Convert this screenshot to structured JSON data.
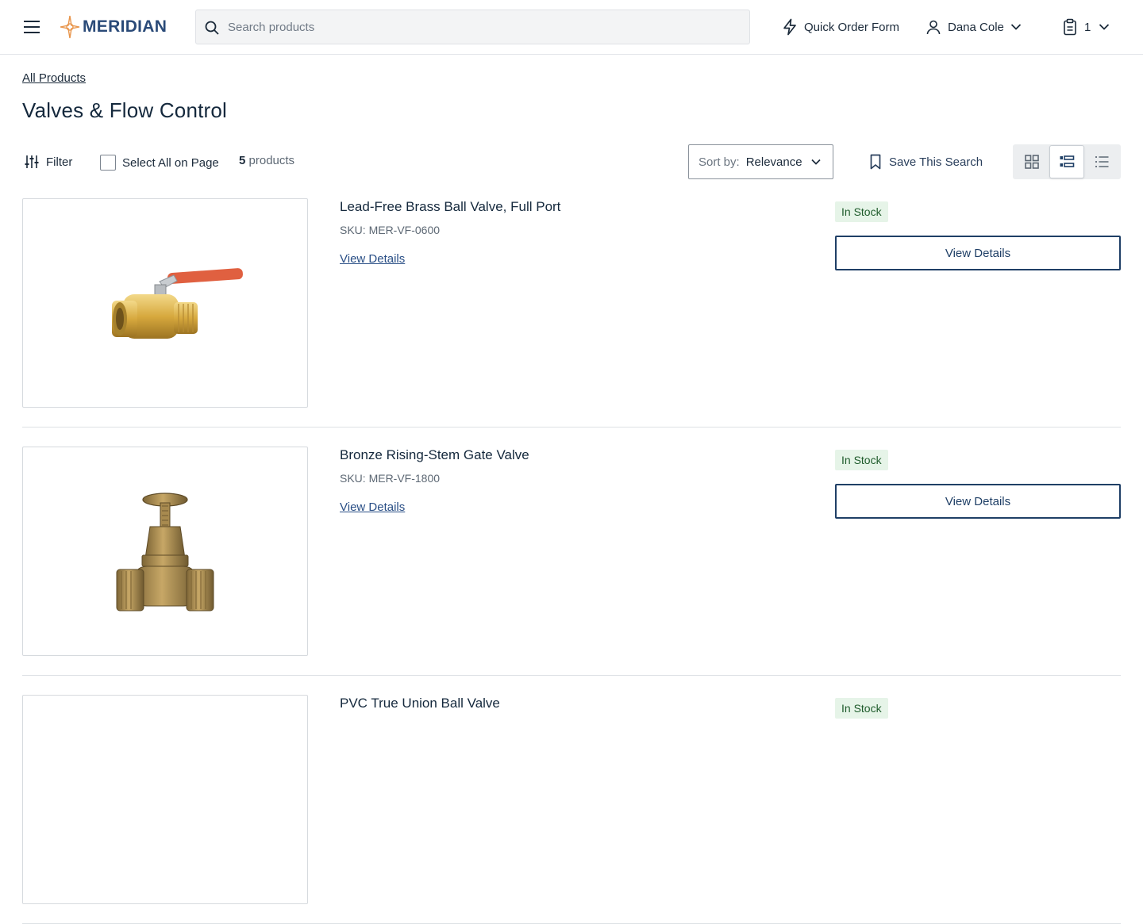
{
  "header": {
    "brand": "MERIDIAN",
    "search_placeholder": "Search products",
    "search_value": "",
    "quick_order_label": "Quick Order Form",
    "user_name": "Dana Cole",
    "cart_count": "1"
  },
  "breadcrumb": {
    "label": "All Products"
  },
  "page": {
    "title": "Valves & Flow Control"
  },
  "toolbar": {
    "filter_label": "Filter",
    "select_all_label": "Select All on Page",
    "count_number": "5",
    "count_suffix": "products",
    "sort_label": "Sort by:",
    "sort_value": "Relevance",
    "save_search_label": "Save This Search",
    "active_view": "list-detailed"
  },
  "products": [
    {
      "name": "Lead-Free Brass Ball Valve, Full Port",
      "sku": "SKU: MER-VF-0600",
      "link_label": "View Details",
      "stock": "In Stock",
      "button_label": "View Details",
      "image": "brass-ball-valve"
    },
    {
      "name": "Bronze Rising-Stem Gate Valve",
      "sku": "SKU: MER-VF-1800",
      "link_label": "View Details",
      "stock": "In Stock",
      "button_label": "View Details",
      "image": "bronze-gate-valve"
    },
    {
      "name": "PVC True Union Ball Valve",
      "sku": "",
      "link_label": "",
      "stock": "In Stock",
      "button_label": "",
      "image": ""
    }
  ],
  "colors": {
    "brand_blue": "#2a4a78",
    "logo_orange": "#e8944a",
    "stock_bg": "#e6f4e8",
    "stock_text": "#1e5b2b",
    "button_border": "#1f3f66"
  }
}
